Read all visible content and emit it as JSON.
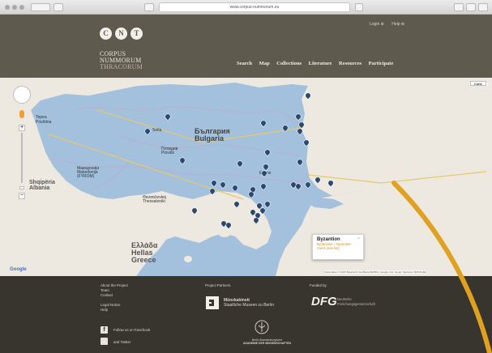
{
  "browser": {
    "url": "www.corpus-nummorum.eu"
  },
  "header": {
    "logo_letters": [
      "C",
      "N",
      "T"
    ],
    "logo_line1": "CORPUS",
    "logo_line2": "NUMMORUM",
    "logo_line3": "THRACORUM",
    "top_links": [
      "Login ⊕",
      "Help ⊕"
    ],
    "nav": [
      "Search",
      "Map",
      "Collections",
      "Literature",
      "Resources",
      "Participate"
    ]
  },
  "map": {
    "map_type_label": "Karte",
    "labels": {
      "bulgaria_native": "България",
      "bulgaria": "Bulgaria",
      "albania_native": "Shqipëria",
      "albania": "Albania",
      "greece_native": "Ελλάδα",
      "greece_2": "Hellas",
      "greece": "Greece",
      "fyrom_1": "Македонија",
      "fyrom_2": "Makedonija",
      "fyrom_3": "(FYROM)",
      "serbia_1": "Tepea",
      "serbia_2": "Prishtina",
      "thessaloniki_native": "Θεσσαλονίκη",
      "thessaloniki": "Thessaloniki",
      "plovdiv_native": "Пловдив",
      "plovdiv": "Plovdiv",
      "sofia": "Sofia",
      "edirne": "Edirne"
    },
    "popup": {
      "title": "Byzantion",
      "link1": "Byzantium – Byzantion",
      "link2": "Coins (see list)"
    },
    "attribution_left": "Google",
    "attribution_right": "Kartendaten © 2015 Basarsoft, GeoBasis-DE/BKG, Google, Inst. Geogr. Nacional, ORION-ME"
  },
  "footer": {
    "col1": [
      "About the Project",
      "Team",
      "Contact",
      "",
      "Legal Notice",
      "Help"
    ],
    "social": {
      "facebook": "Follow us on Facebook",
      "twitter": "and Twitter"
    },
    "partners_heading": "Project Partners",
    "muenz_line1": "Münzkabinett",
    "muenz_line2": "Staatliche Museen zu Berlin",
    "bbaw_line1": "Berlin-Brandenburgische",
    "bbaw_line2": "AKADEMIE DER WISSENSCHAFTEN",
    "funded_heading": "Funded by",
    "dfg": "DFG",
    "dfg_line1": "Deutsche",
    "dfg_line2": "Forschungsgemeinschaft"
  },
  "colors": {
    "header_bg": "#5e5a4d",
    "footer_bg": "#38352e",
    "water": "#a3c0dc",
    "land": "#ede9e0",
    "marker": "#2c4770",
    "accent_swoosh": "#e0a020"
  }
}
